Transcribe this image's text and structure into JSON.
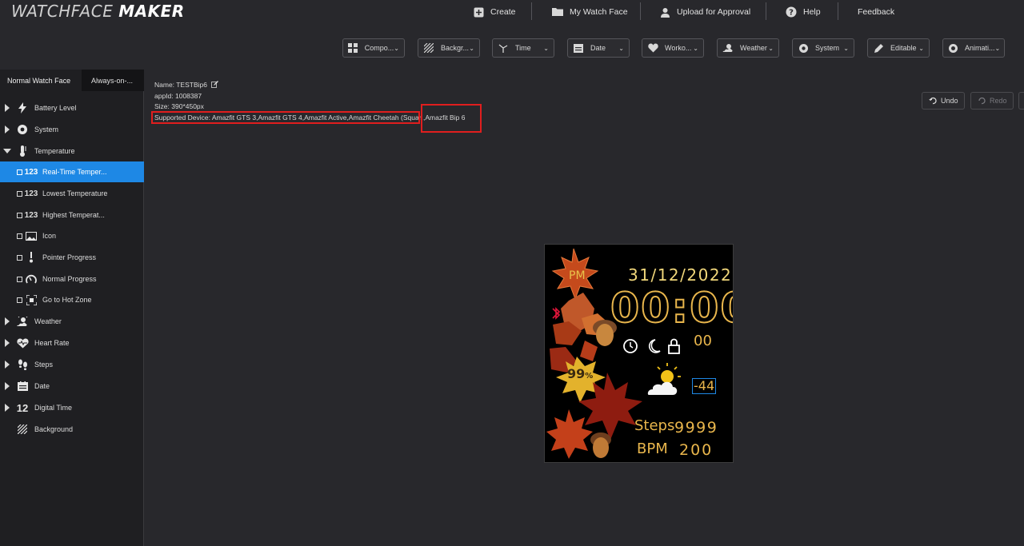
{
  "app": {
    "logo_light": "WATCHFACE",
    "logo_bold": "MAKER"
  },
  "topnav": {
    "create": "Create",
    "my_watch_face": "My Watch Face",
    "upload": "Upload for Approval",
    "help": "Help",
    "feedback": "Feedback"
  },
  "toolbar": {
    "components": "Compo...",
    "background": "Backgr...",
    "time": "Time",
    "date": "Date",
    "workout": "Worko...",
    "weather": "Weather",
    "system": "System",
    "editable": "Editable",
    "animation": "Animati..."
  },
  "tabs": {
    "normal": "Normal Watch Face",
    "aod": "Always-on-..."
  },
  "tree": {
    "battery": "Battery Level",
    "system": "System",
    "temperature": "Temperature",
    "realtime": "Real-Time Temper...",
    "lowest": "Lowest Temperature",
    "highest": "Highest Temperat...",
    "icon": "Icon",
    "pointer": "Pointer Progress",
    "normal_progress": "Normal Progress",
    "hotzone": "Go to Hot Zone",
    "weather": "Weather",
    "heart": "Heart Rate",
    "steps": "Steps",
    "date": "Date",
    "digital": "Digital Time",
    "background": "Background",
    "badge_123": "123",
    "badge_12": "12"
  },
  "info": {
    "name": "Name:  TESTBip6",
    "appid": "appId:  1008387",
    "size": "Size:  390*450px",
    "devices": "Supported Device:  Amazfit GTS 3,Amazfit GTS 4,Amazfit Active,Amazfit Cheetah (Squar",
    "extra_device": ",Amazfit Bip 6"
  },
  "history": {
    "undo": "Undo",
    "redo": "Redo"
  },
  "watch": {
    "ampm": "PM",
    "date": "31/12/2022",
    "time": "00:00",
    "seconds": "00",
    "battery": "99",
    "battery_unit": "%",
    "temperature": "-44",
    "steps_label": "Steps",
    "steps_value": "9999",
    "bpm_label": "BPM",
    "bpm_value": "200"
  },
  "colors": {
    "accent": "#1e88e5",
    "highlight": "#e01e1e",
    "watch_gold": "#e8b44a"
  }
}
